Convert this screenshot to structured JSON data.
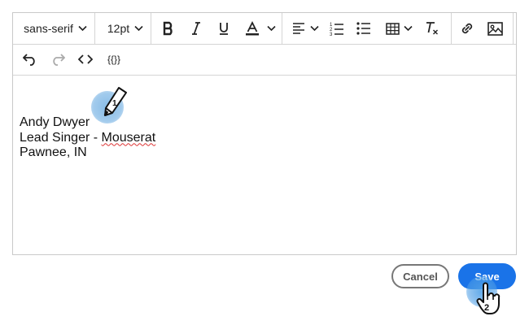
{
  "toolbar": {
    "font_family": "sans-serif",
    "font_size": "12pt"
  },
  "row2": {
    "code_sample_label": "{{}}"
  },
  "content": {
    "lines": [
      "Andy Dwyer",
      "Lead Singer - ",
      "Mouserat",
      "Pawnee, IN"
    ]
  },
  "buttons": {
    "cancel": "Cancel",
    "save": "Save"
  },
  "markers": {
    "pen_number": "1",
    "hand_number": "2"
  },
  "colors": {
    "save_button": "#1a73e8",
    "marker": "#82b9e6"
  }
}
